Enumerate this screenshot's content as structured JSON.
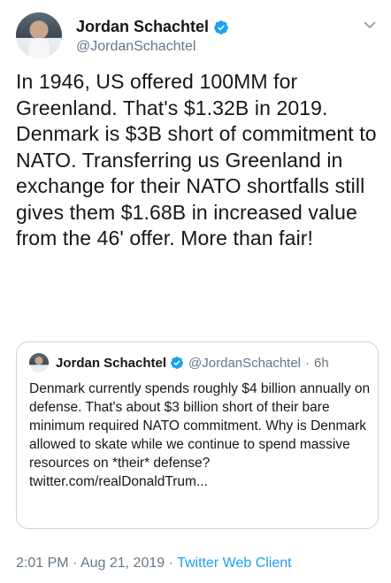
{
  "author": {
    "display_name": "Jordan Schachtel",
    "handle": "@JordanSchachtel",
    "verified": true
  },
  "tweet": {
    "text": "In 1946, US offered 100MM for Greenland. That's $1.32B in 2019. Denmark is $3B short of commitment to NATO. Transferring us Greenland in exchange for their NATO shortfalls still gives them $1.68B in increased value from the 46' offer. More than fair!"
  },
  "quoted_tweet": {
    "display_name": "Jordan Schachtel",
    "handle": "@JordanSchachtel",
    "separator": "·",
    "time": "6h",
    "text": "Denmark currently spends roughly $4 billion annually on defense. That's about $3 billion short of their bare minimum required NATO commitment. Why is Denmark allowed to skate while we continue to spend massive resources on *their* defense?",
    "link": "twitter.com/realDonaldTrum..."
  },
  "meta": {
    "time": "2:01 PM",
    "separator": "·",
    "date": "Aug 21, 2019",
    "client": "Twitter Web Client"
  },
  "colors": {
    "accent": "#1da1f2",
    "secondary_text": "#657786",
    "border": "#ccd6dd"
  },
  "icons": [
    "verified-icon",
    "chevron-down-icon"
  ]
}
